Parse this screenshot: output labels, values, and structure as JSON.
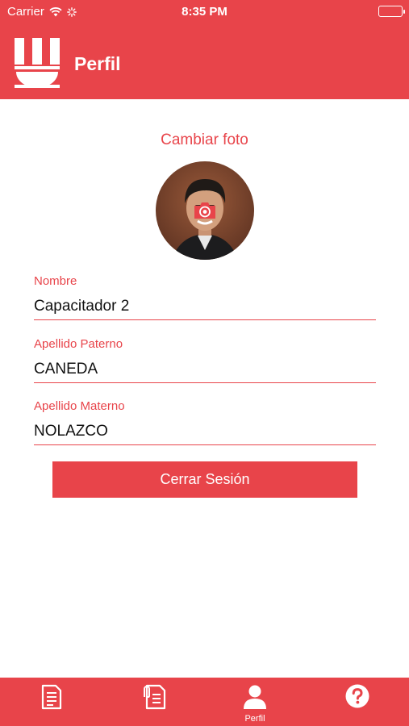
{
  "status_bar": {
    "carrier": "Carrier",
    "time": "8:35 PM",
    "icons": [
      "wifi-icon",
      "activity-icon",
      "battery-icon"
    ]
  },
  "nav": {
    "title": "Perfil",
    "logo": "app-logo"
  },
  "profile": {
    "change_photo_label": "Cambiar foto",
    "avatar": "profile-photo",
    "camera_icon": "camera-icon"
  },
  "form": {
    "fields": [
      {
        "label": "Nombre",
        "value": "Capacitador 2"
      },
      {
        "label": "Apellido Paterno",
        "value": "CANEDA"
      },
      {
        "label": "Apellido Materno",
        "value": "NOLAZCO"
      }
    ],
    "logout_label": "Cerrar Sesión"
  },
  "tab_bar": {
    "tabs": [
      {
        "icon": "document-icon",
        "label": ""
      },
      {
        "icon": "attachment-document-icon",
        "label": ""
      },
      {
        "icon": "user-icon",
        "label": "Perfil",
        "active": true
      },
      {
        "icon": "help-icon",
        "label": ""
      }
    ]
  },
  "colors": {
    "accent": "#e8444a",
    "text": "#111111",
    "background": "#ffffff"
  }
}
